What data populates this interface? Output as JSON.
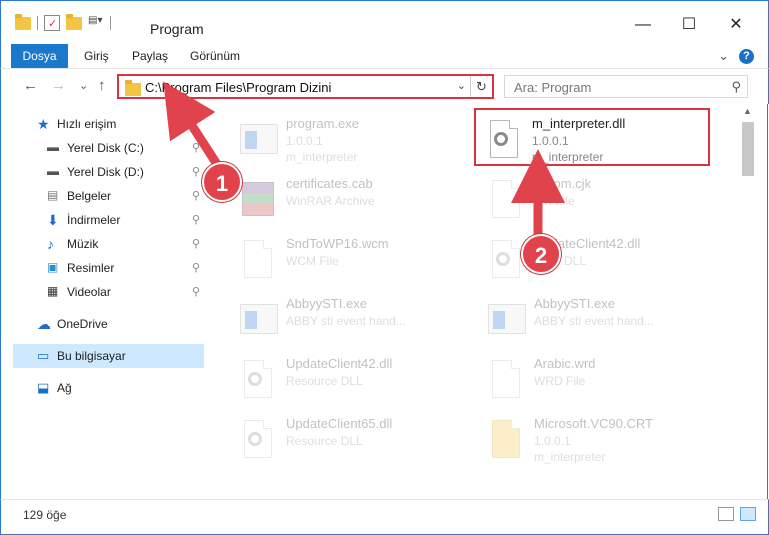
{
  "window": {
    "title": "Program",
    "minimize": "—",
    "maximize": "☐",
    "close": "✕"
  },
  "ribbon": {
    "tabs": [
      "Dosya",
      "Giriş",
      "Paylaş",
      "Görünüm"
    ],
    "collapse": "⌄",
    "help": "?"
  },
  "address": {
    "path": "C:\\Program Files\\Program Dizini",
    "dropdown": "⌄",
    "refresh": "↻",
    "back": "←",
    "forward": "→",
    "recent": "⌄",
    "up": "↑"
  },
  "search": {
    "placeholder": "Ara: Program",
    "icon": "⚲"
  },
  "sidebar": {
    "items": [
      {
        "label": "Hızlı erişim",
        "icon": "star-icon",
        "pinned": false
      },
      {
        "label": "Yerel Disk (C:)",
        "icon": "drive-icon",
        "pinned": true
      },
      {
        "label": "Yerel Disk (D:)",
        "icon": "drive-icon",
        "pinned": true
      },
      {
        "label": "Belgeler",
        "icon": "documents-icon",
        "pinned": true
      },
      {
        "label": "İndirmeler",
        "icon": "downloads-icon",
        "pinned": true
      },
      {
        "label": "Müzik",
        "icon": "music-icon",
        "pinned": true
      },
      {
        "label": "Resimler",
        "icon": "pictures-icon",
        "pinned": true
      },
      {
        "label": "Videolar",
        "icon": "videos-icon",
        "pinned": true
      },
      {
        "label": "OneDrive",
        "icon": "cloud-icon",
        "pinned": false
      },
      {
        "label": "Bu bilgisayar",
        "icon": "computer-icon",
        "pinned": false,
        "selected": true
      },
      {
        "label": "Ağ",
        "icon": "network-icon",
        "pinned": false
      }
    ],
    "pin_glyph": "📌"
  },
  "files": [
    {
      "name": "program.exe",
      "l2": "1.0.0.1",
      "l3": "m_interpreter",
      "icon": "exe-icon"
    },
    {
      "name": "m_interpreter.dll",
      "l2": "1.0.0.1",
      "l3": "m_interpreter",
      "icon": "dll-icon",
      "highlighted": true
    },
    {
      "name": "certificates.cab",
      "l2": "WinRAR Archive",
      "l3": "",
      "icon": "cab-icon"
    },
    {
      "name": "...Kom.cjk",
      "l2": "...K File",
      "l3": "",
      "icon": "file-icon"
    },
    {
      "name": "SndToWP16.wcm",
      "l2": "WCM File",
      "l3": "",
      "icon": "file-icon"
    },
    {
      "name": "UpdateClient42.dll",
      "l2": "...rce DLL",
      "l3": "",
      "icon": "dll-icon"
    },
    {
      "name": "AbbyySTI.exe",
      "l2": "ABBY sti event hand...",
      "l3": "",
      "icon": "exe-icon"
    },
    {
      "name": "AbbyySTI.exe",
      "l2": "ABBY sti event hand...",
      "l3": "",
      "icon": "exe-icon"
    },
    {
      "name": "UpdateClient42.dll",
      "l2": "Resource DLL",
      "l3": "",
      "icon": "dll-icon"
    },
    {
      "name": "Arabic.wrd",
      "l2": "WRD File",
      "l3": "",
      "icon": "file-icon"
    },
    {
      "name": "UpdateClient65.dll",
      "l2": "Resource DLL",
      "l3": "",
      "icon": "dll-icon"
    },
    {
      "name": "Microsoft.VC90.CRT",
      "l2": "1.0.0.1",
      "l3": "m_interpreter",
      "icon": "folder-icon"
    }
  ],
  "status": {
    "count": "129 öğe"
  },
  "steps": [
    "1",
    "2"
  ],
  "colors": {
    "accent": "#1979ca",
    "highlight": "#d9333f",
    "selected": "#cde8ff",
    "badge": "#e0434b"
  }
}
